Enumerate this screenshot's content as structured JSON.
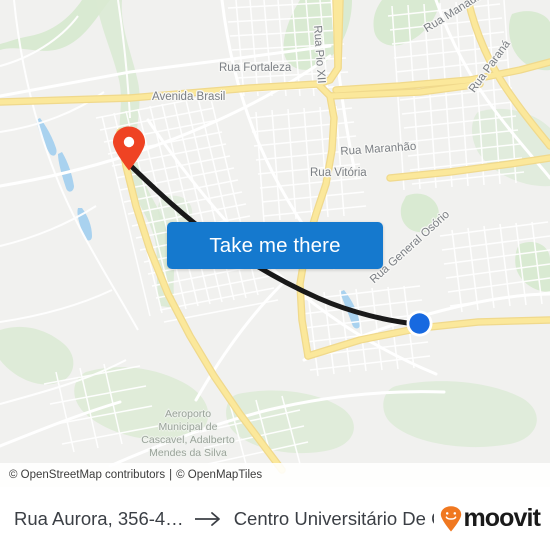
{
  "map": {
    "background_color": "#e9eaea",
    "road_color": "#ffffff",
    "highway_color": "#fbe38a",
    "park_color": "#d7ead0",
    "water_color": "#a9d2ef",
    "street_labels": [
      {
        "name": "Rua Fortaleza",
        "text": "Rua Fortaleza"
      },
      {
        "name": "Avenida Brasil",
        "text": "Avenida Brasil"
      },
      {
        "name": "Rua Pio XII",
        "text": "Rua Pio XII"
      },
      {
        "name": "Rua Manaus",
        "text": "Rua Manaus"
      },
      {
        "name": "Rua Parana",
        "text": "Rua Paraná"
      },
      {
        "name": "Rua Maranhao",
        "text": "Rua Maranhão"
      },
      {
        "name": "Rua Vitoria",
        "text": "Rua Vitória"
      },
      {
        "name": "Rua General Osorio",
        "text": "Rua General Osório"
      }
    ],
    "poi_labels": [
      {
        "name": "airport",
        "text": "Aeroporto\nMunicipal de\nCascavel, Adalberto\nMendes da Silva"
      }
    ],
    "origin_marker": {
      "icon": "map-pin-icon",
      "color": "#ef4323"
    },
    "destination_dot": {
      "icon": "location-dot-icon",
      "color": "#1769e0"
    },
    "route_line": {
      "color": "#191919",
      "width": 5
    }
  },
  "take_me_there_button": {
    "label": "Take me there",
    "background": "#1579ce",
    "text_color": "#ffffff"
  },
  "attribution": {
    "osm": "© OpenStreetMap contributors",
    "separator": "|",
    "tiles": "© OpenMapTiles"
  },
  "bottom_bar": {
    "origin": "Rua Aurora, 356-4…",
    "arrow": "→",
    "destination": "Centro Universitário De Casca…",
    "brand": {
      "wordmark": "moovit",
      "mark_color": "#f07820",
      "text_color": "#1a1a1a"
    }
  }
}
